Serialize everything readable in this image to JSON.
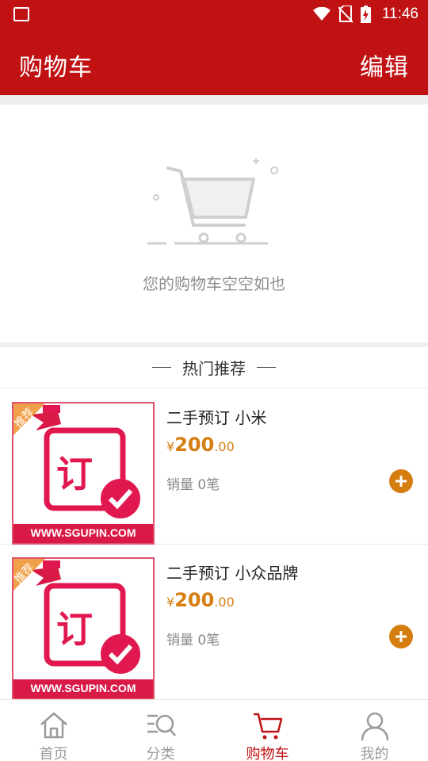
{
  "status_bar": {
    "time": "11:46",
    "icons": [
      "image-icon",
      "wifi-icon",
      "no-sim-icon",
      "battery-charging-icon"
    ]
  },
  "header": {
    "title": "购物车",
    "edit_label": "编辑"
  },
  "cart": {
    "empty_message": "您的购物车空空如也"
  },
  "recommend": {
    "heading": "热门推荐",
    "items": [
      {
        "name": "二手预订 小米",
        "currency": "¥",
        "price_int": "200",
        "price_dec": ".00",
        "sales": "销量 0笔",
        "badge": "推荐",
        "thumb_char": "订",
        "thumb_url": "WWW.SGUPIN.COM"
      },
      {
        "name": "二手预订 小众品牌",
        "currency": "¥",
        "price_int": "200",
        "price_dec": ".00",
        "sales": "销量 0笔",
        "badge": "推荐",
        "thumb_char": "订",
        "thumb_url": "WWW.SGUPIN.COM"
      }
    ]
  },
  "tabbar": {
    "tabs": [
      {
        "label": "首页",
        "icon": "home-icon",
        "active": false
      },
      {
        "label": "分类",
        "icon": "category-search-icon",
        "active": false
      },
      {
        "label": "购物车",
        "icon": "cart-icon",
        "active": true
      },
      {
        "label": "我的",
        "icon": "user-icon",
        "active": false
      }
    ]
  },
  "colors": {
    "primary": "#c01113",
    "accent": "#d67d10",
    "background": "#efefef"
  }
}
